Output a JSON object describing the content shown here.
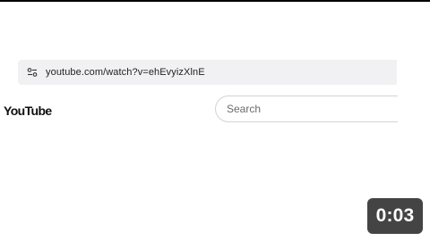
{
  "browser": {
    "url": "youtube.com/watch?v=ehEvyizXlnE",
    "site_settings_icon": "tune-icon"
  },
  "youtube": {
    "logo_text": "YouTube",
    "search": {
      "placeholder": "Search",
      "value": ""
    }
  },
  "video": {
    "duration": "0:03"
  },
  "colors": {
    "address_bar_bg": "#f1f1f3",
    "badge_bg": "#444444",
    "text": "#1f1f1f"
  }
}
